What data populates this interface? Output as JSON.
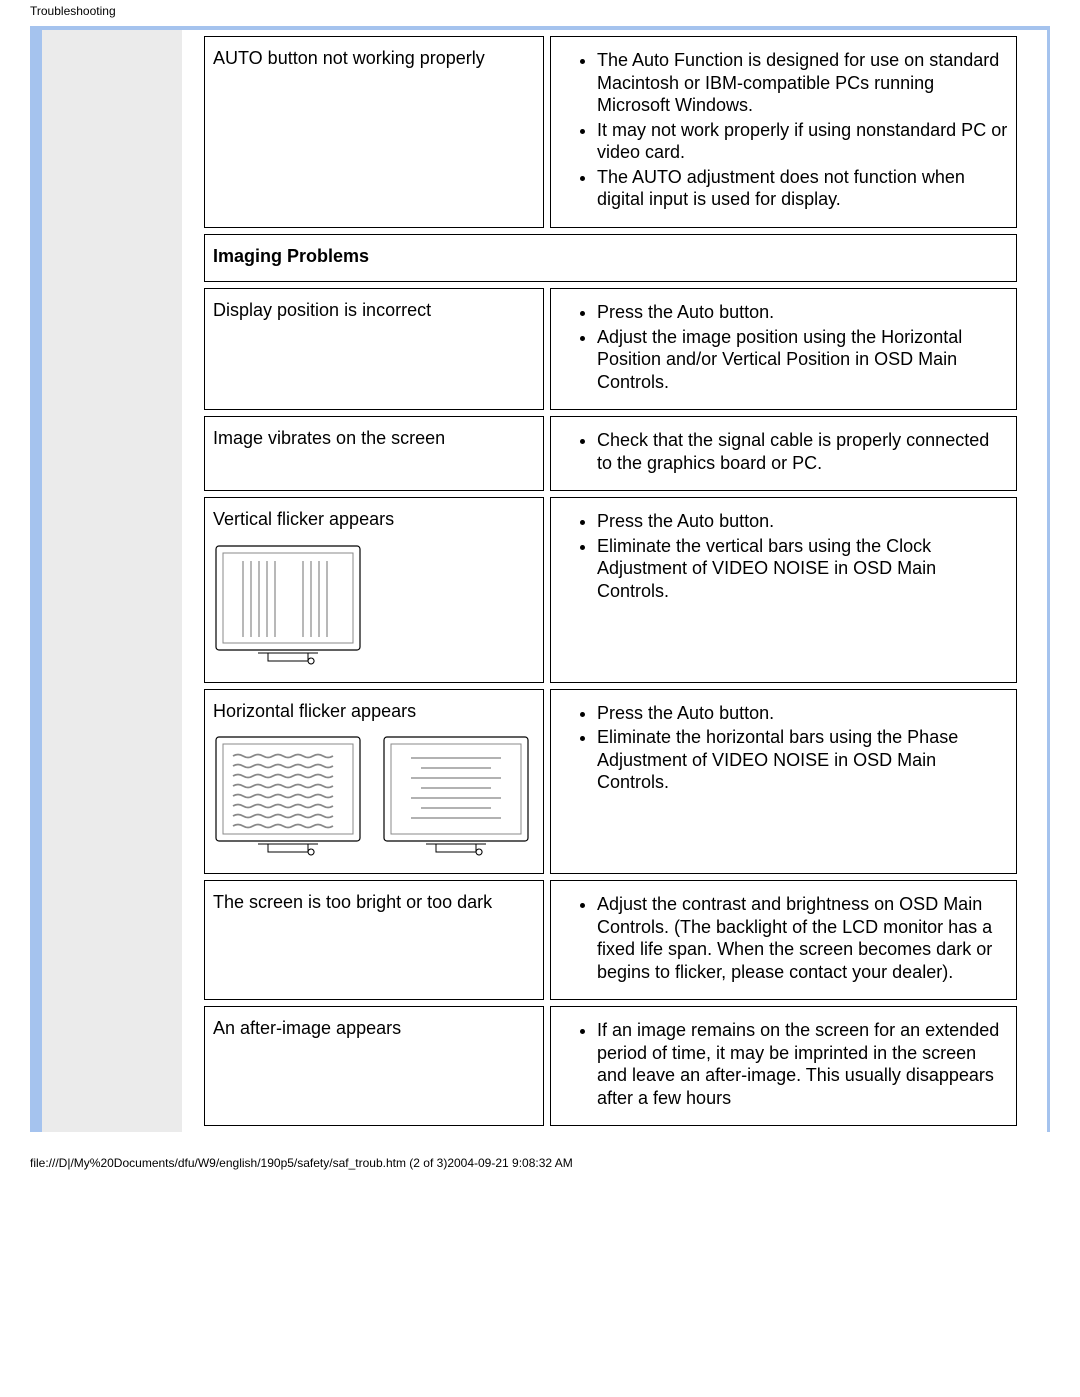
{
  "header": "Troubleshooting",
  "rows": {
    "auto_button": {
      "left": "AUTO button not working properly",
      "items": [
        "The Auto Function is designed for use on standard Macintosh or IBM-compatible PCs running Microsoft Windows.",
        "It may not work properly if using nonstandard PC or video card.",
        "The AUTO adjustment does not function when digital input is used for display."
      ]
    },
    "section_title": "Imaging Problems",
    "display_pos": {
      "left": "Display position is incorrect",
      "items": [
        "Press the Auto button.",
        "Adjust the image position using the Horizontal Position and/or Vertical Position in OSD Main Controls."
      ]
    },
    "vibrates": {
      "left": "Image vibrates on the screen",
      "items": [
        "Check that the signal cable is properly connected to the graphics board or PC."
      ]
    },
    "vflicker": {
      "left": "Vertical flicker appears",
      "items": [
        "Press the Auto button.",
        "Eliminate the vertical bars using the Clock Adjustment of VIDEO NOISE in OSD Main Controls."
      ]
    },
    "hflicker": {
      "left": "Horizontal flicker appears",
      "items": [
        "Press the Auto button.",
        "Eliminate the horizontal bars using the Phase Adjustment of VIDEO NOISE in OSD Main Controls."
      ]
    },
    "brightness": {
      "left": "The screen is too bright or too dark",
      "items": [
        "Adjust the contrast and brightness on OSD Main Controls. (The backlight of the LCD monitor has a fixed life span. When the screen becomes dark or begins to flicker, please contact your dealer)."
      ]
    },
    "afterimage": {
      "left": "An after-image appears",
      "items": [
        "If an image remains on the screen for an extended period of time, it may be imprinted in the screen and leave an after-image. This usually disappears after a few hours"
      ]
    }
  },
  "footer": "file:///D|/My%20Documents/dfu/W9/english/190p5/safety/saf_troub.htm (2 of 3)2004-09-21 9:08:32 AM"
}
